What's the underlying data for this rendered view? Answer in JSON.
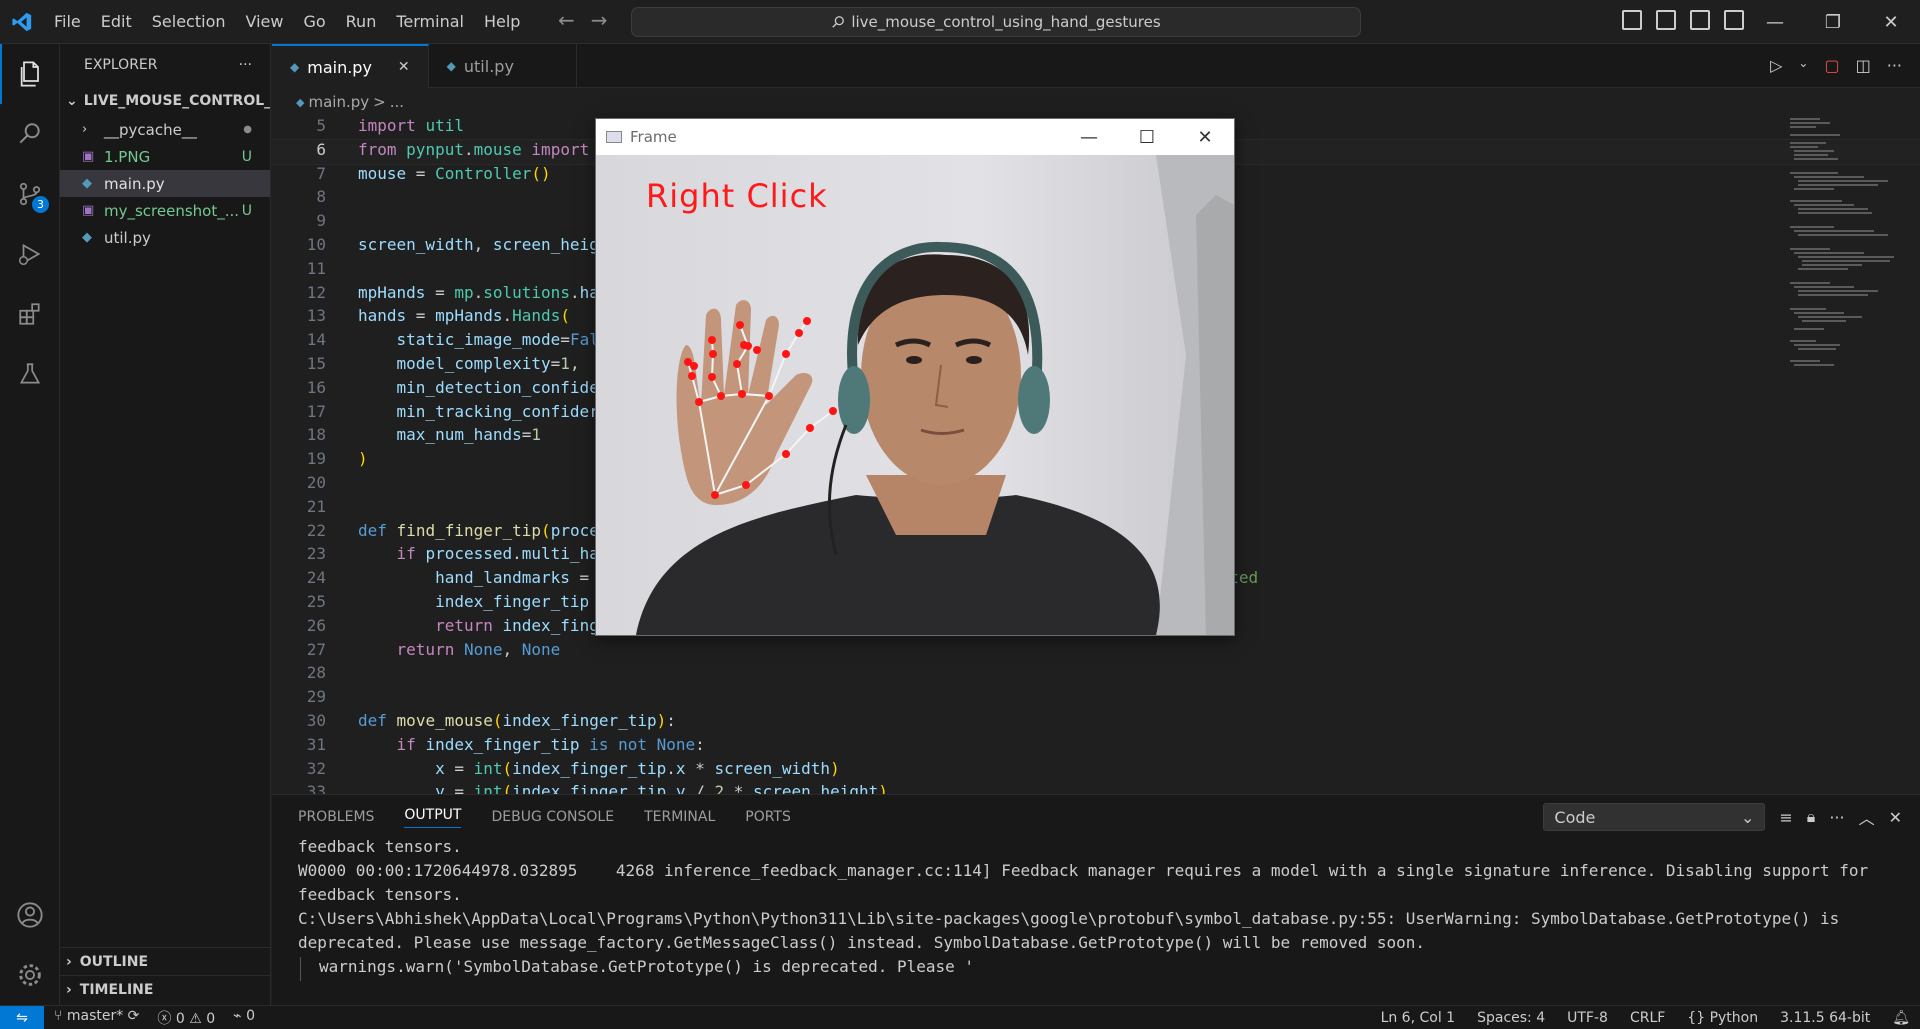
{
  "titlebar": {
    "menu": [
      "File",
      "Edit",
      "Selection",
      "View",
      "Go",
      "Run",
      "Terminal",
      "Help"
    ],
    "search_text": "live_mouse_control_using_hand_gestures"
  },
  "activitybar": {
    "items": [
      "explorer-icon",
      "search-icon",
      "source-control-icon",
      "run-debug-icon",
      "extensions-icon",
      "testing-icon"
    ],
    "source_control_badge": "3",
    "bottom": [
      "account-icon",
      "settings-gear-icon"
    ]
  },
  "sidebar": {
    "title": "EXPLORER",
    "more": "···",
    "folder": "LIVE_MOUSE_CONTROL_U...",
    "files": [
      {
        "name": "__pycache__",
        "status": "●",
        "color": "#cccccc",
        "type": "folder"
      },
      {
        "name": "1.PNG",
        "status": "U",
        "color": "#73c991",
        "type": "image"
      },
      {
        "name": "main.py",
        "status": "",
        "color": "#cccccc",
        "type": "python"
      },
      {
        "name": "my_screenshot_...",
        "status": "U",
        "color": "#73c991",
        "type": "image"
      },
      {
        "name": "util.py",
        "status": "",
        "color": "#cccccc",
        "type": "python"
      }
    ],
    "outline": "OUTLINE",
    "timeline": "TIMELINE"
  },
  "tabs": [
    {
      "label": "main.py",
      "active": true
    },
    {
      "label": "util.py",
      "active": false
    }
  ],
  "breadcrumb": {
    "file": "main.py",
    "sep": ">",
    "rest": "..."
  },
  "editor": {
    "current_line": 6,
    "lines": [
      {
        "n": "5",
        "t": "import util"
      },
      {
        "n": "6",
        "t": "from pynput.mouse import"
      },
      {
        "n": "7",
        "t": "mouse = Controller()"
      },
      {
        "n": "8",
        "t": ""
      },
      {
        "n": "9",
        "t": ""
      },
      {
        "n": "10",
        "t": "screen_width, screen_heig"
      },
      {
        "n": "11",
        "t": ""
      },
      {
        "n": "12",
        "t": "mpHands = mp.solutions.ha"
      },
      {
        "n": "13",
        "t": "hands = mpHands.Hands("
      },
      {
        "n": "14",
        "t": "    static_image_mode=Fal"
      },
      {
        "n": "15",
        "t": "    model_complexity=1,"
      },
      {
        "n": "16",
        "t": "    min_detection_confide"
      },
      {
        "n": "17",
        "t": "    min_tracking_confider"
      },
      {
        "n": "18",
        "t": "    max_num_hands=1"
      },
      {
        "n": "19",
        "t": ")"
      },
      {
        "n": "20",
        "t": ""
      },
      {
        "n": "21",
        "t": ""
      },
      {
        "n": "22",
        "t": "def find_finger_tip(proce"
      },
      {
        "n": "23",
        "t": "    if processed.multi_ha"
      },
      {
        "n": "24",
        "t": "        hand_landmarks ="
      },
      {
        "n": "25",
        "t": "        index_finger_tip"
      },
      {
        "n": "26",
        "t": "        return index_fing"
      },
      {
        "n": "27",
        "t": "    return None, None"
      },
      {
        "n": "28",
        "t": ""
      },
      {
        "n": "29",
        "t": ""
      },
      {
        "n": "30",
        "t": "def move_mouse(index_finger_tip):"
      },
      {
        "n": "31",
        "t": "    if index_finger_tip is not None:"
      },
      {
        "n": "32",
        "t": "        x = int(index_finger_tip.x * screen_width)"
      },
      {
        "n": "33",
        "t": "        y = int(index_finger_tip.y / 2 * screen_height)"
      }
    ],
    "line24_tail": "ected"
  },
  "frame_window": {
    "title": "Frame",
    "caption": "Right Click"
  },
  "panel": {
    "tabs": [
      "PROBLEMS",
      "OUTPUT",
      "DEBUG CONSOLE",
      "TERMINAL",
      "PORTS"
    ],
    "active_tab": "OUTPUT",
    "channel": "Code",
    "output": [
      "feedback tensors.",
      "W0000 00:00:1720644978.032895    4268 inference_feedback_manager.cc:114] Feedback manager requires a model with a single signature inference. Disabling support for",
      "feedback tensors.",
      "C:\\Users\\Abhishek\\AppData\\Local\\Programs\\Python\\Python311\\Lib\\site-packages\\google\\protobuf\\symbol_database.py:55: UserWarning: SymbolDatabase.GetPrototype() is",
      "deprecated. Please use message_factory.GetMessageClass() instead. SymbolDatabase.GetPrototype() will be removed soon.",
      "warnings.warn('SymbolDatabase.GetPrototype() is deprecated. Please '"
    ]
  },
  "statusbar": {
    "branch": "master*",
    "errors": "0",
    "warnings": "0",
    "ports": "0",
    "position": "Ln 6, Col 1",
    "spaces": "Spaces: 4",
    "encoding": "UTF-8",
    "eol": "CRLF",
    "language": "Python",
    "interpreter": "3.11.5 64-bit"
  },
  "colors": {
    "accent": "#0078d4",
    "caption": "#ff1a1a",
    "untracked": "#73c991"
  }
}
